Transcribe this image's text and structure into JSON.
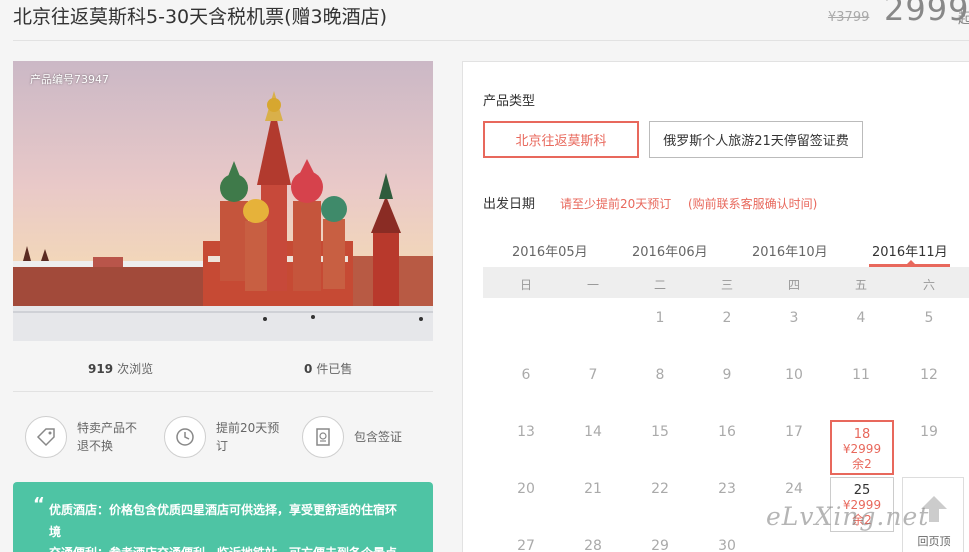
{
  "product": {
    "title": "北京往返莫斯科5-30天含税机票(赠3晚酒店)",
    "original_price": "¥3799",
    "price": "2999",
    "price_unit": "起",
    "code_label": "产品编号73947"
  },
  "stats": {
    "views_count": "919",
    "views_label": "次浏览",
    "sold_count": "0",
    "sold_label": "件已售"
  },
  "features": [
    {
      "icon": "tag-icon",
      "line1": "特卖产品不",
      "line2": "退不换"
    },
    {
      "icon": "clock-icon",
      "line1": "提前20天预",
      "line2": "订"
    },
    {
      "icon": "passport-icon",
      "line1": "包含签证",
      "line2": ""
    }
  ],
  "highlights": {
    "line1": "优质酒店：价格包含优质四星酒店可供选择，享受更舒适的住宿环",
    "line1b": "境",
    "line2": "交通便利：参考酒店交通便利，临近地铁站，可方便去到各个景点"
  },
  "booking": {
    "type_label": "产品类型",
    "types": [
      "北京往返莫斯科",
      "俄罗斯个人旅游21天停留签证费"
    ],
    "date_label": "出发日期",
    "note1": "请至少提前20天预订",
    "note2": "(购前联系客服确认时间)",
    "months": [
      "2016年05月",
      "2016年06月",
      "2016年10月",
      "2016年11月"
    ],
    "active_month": "2016年11月",
    "weekdays": [
      "日",
      "一",
      "二",
      "三",
      "四",
      "五",
      "六"
    ],
    "rows": [
      [
        "",
        "",
        "1",
        "2",
        "3",
        "4",
        "5"
      ],
      [
        "6",
        "7",
        "8",
        "9",
        "10",
        "11",
        "12"
      ],
      [
        "13",
        "14",
        "15",
        "16",
        "17",
        "",
        "19"
      ],
      [
        "20",
        "21",
        "22",
        "23",
        "24",
        "",
        ""
      ],
      [
        "27",
        "28",
        "29",
        "30",
        "",
        "",
        ""
      ]
    ],
    "selected_day": {
      "day": "18",
      "price": "¥2999",
      "remaining": "余2"
    },
    "available_day": {
      "day": "25",
      "price": "¥2999",
      "remaining": "余2"
    }
  },
  "back_to_top": "回页顶",
  "watermark": "eLvXing.net",
  "colors": {
    "accent": "#e8685c",
    "teal": "#4ec4a4"
  }
}
